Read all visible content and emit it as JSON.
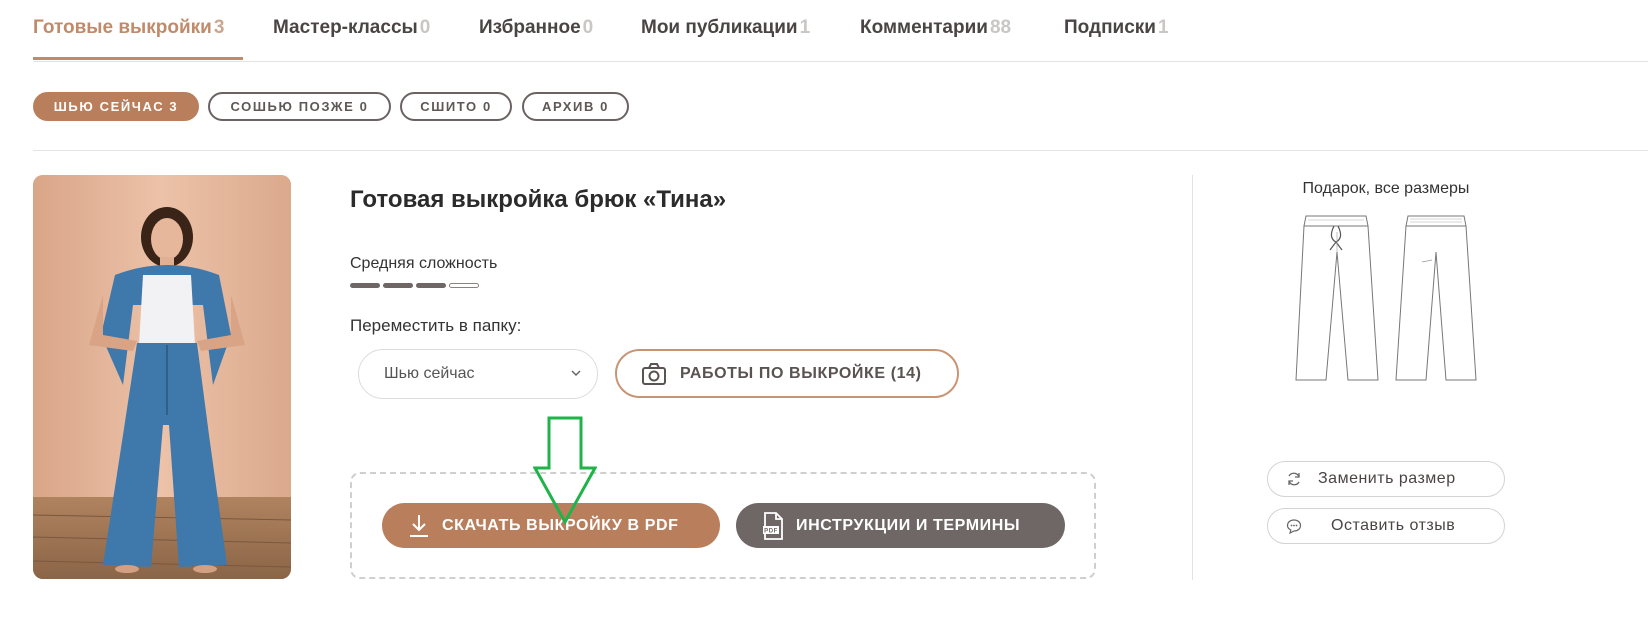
{
  "tabs": [
    {
      "label": "Готовые выкройки",
      "count": "3",
      "active": true
    },
    {
      "label": "Мастер-классы",
      "count": "0",
      "active": false
    },
    {
      "label": "Избранное",
      "count": "0",
      "active": false
    },
    {
      "label": "Мои публикации",
      "count": "1",
      "active": false
    },
    {
      "label": "Комментарии",
      "count": "88",
      "active": false
    },
    {
      "label": "Подписки",
      "count": "1",
      "active": false
    }
  ],
  "filters": [
    {
      "label": "ШЬЮ СЕЙЧАС 3",
      "active": true
    },
    {
      "label": "СОШЬЮ ПОЗЖЕ 0",
      "active": false
    },
    {
      "label": "СШИТО 0",
      "active": false
    },
    {
      "label": "АРХИВ 0",
      "active": false
    }
  ],
  "product": {
    "title": "Готовая выкройка брюк «Тина»",
    "difficulty_label": "Средняя сложность",
    "difficulty_level": 3,
    "difficulty_max": 4,
    "move_label": "Переместить в папку:",
    "folder_value": "Шью сейчас",
    "works_button": "РАБОТЫ ПО ВЫКРОЙКЕ (14)",
    "download_button": "СКАЧАТЬ ВЫКРОЙКУ В PDF",
    "instructions_button": "ИНСТРУКЦИИ И ТЕРМИНЫ",
    "pdf_icon_text": "PDF"
  },
  "side": {
    "gift_label": "Подарок, все размеры",
    "change_size_button": "Заменить размер",
    "review_button": "Оставить отзыв"
  },
  "colors": {
    "accent": "#b97f5c",
    "dark_button": "#6f6766",
    "annotation_arrow": "#1fb34a"
  },
  "icons": {
    "works": "camera-icon",
    "download": "download-icon",
    "instructions": "pdf-file-icon",
    "change_size": "refresh-icon",
    "review": "chat-bubble-icon",
    "select": "chevron-down-icon"
  }
}
